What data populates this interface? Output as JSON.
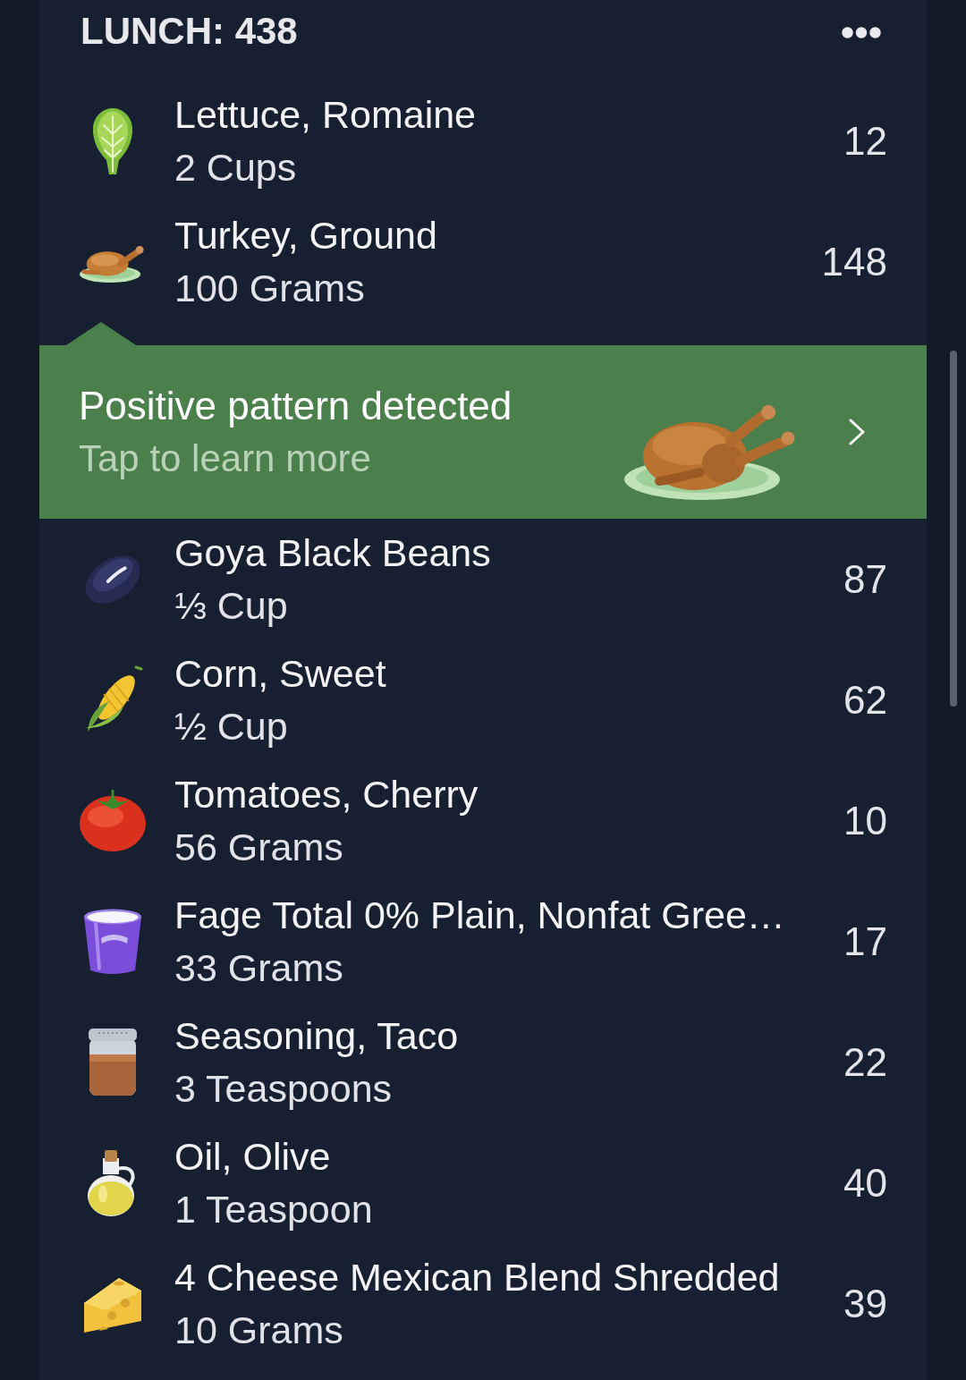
{
  "meal": {
    "title": "LUNCH: 438"
  },
  "entries": [
    {
      "kind": "food",
      "name": "Lettuce, Romaine",
      "amount": "2 Cups",
      "calories": "12"
    },
    {
      "kind": "food",
      "name": "Turkey, Ground",
      "amount": "100 Grams",
      "calories": "148"
    },
    {
      "kind": "insight",
      "title": "Positive pattern detected",
      "subtitle": "Tap to learn more"
    },
    {
      "kind": "food",
      "name": "Goya Black Beans",
      "amount": "⅓ Cup",
      "calories": "87"
    },
    {
      "kind": "food",
      "name": "Corn, Sweet",
      "amount": "½ Cup",
      "calories": "62"
    },
    {
      "kind": "food",
      "name": "Tomatoes, Cherry",
      "amount": "56 Grams",
      "calories": "10"
    },
    {
      "kind": "food",
      "name": "Fage Total 0% Plain, Nonfat Gree…",
      "amount": "33 Grams",
      "calories": "17"
    },
    {
      "kind": "food",
      "name": "Seasoning, Taco",
      "amount": "3 Teaspoons",
      "calories": "22"
    },
    {
      "kind": "food",
      "name": "Oil, Olive",
      "amount": "1 Teaspoon",
      "calories": "40"
    },
    {
      "kind": "food",
      "name": "4 Cheese Mexican Blend Shredded",
      "amount": "10 Grams",
      "calories": "39"
    }
  ]
}
